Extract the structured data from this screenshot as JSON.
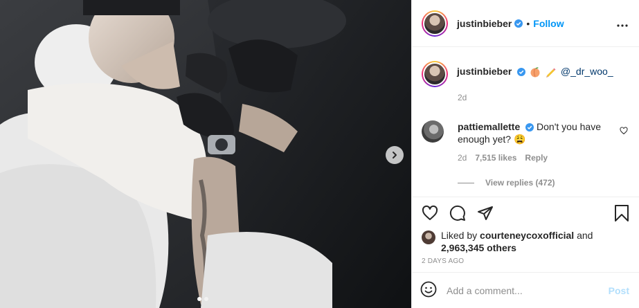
{
  "header": {
    "username": "justinbieber",
    "follow_label": "Follow",
    "separator": "•"
  },
  "caption": {
    "username": "justinbieber",
    "mention": "@_dr_woo_",
    "time": "2d"
  },
  "comment": {
    "username": "pattiemallette",
    "text": "Don't you have enough yet? 😩",
    "time": "2d",
    "likes": "7,515 likes",
    "reply_label": "Reply",
    "view_replies": "View replies (472)"
  },
  "likes": {
    "prefix": "Liked by ",
    "user": "courteneycoxofficial",
    "middle": " and",
    "others": "2,963,345 others"
  },
  "posted": "2 DAYS AGO",
  "add_comment": {
    "placeholder": "Add a comment...",
    "post_label": "Post"
  },
  "colors": {
    "accent": "#0095f6",
    "verified": "#3897f0",
    "muted": "#8e8e8e",
    "post_disabled": "#b2dffc"
  },
  "icons": [
    "more-options-icon",
    "verified-badge-icon",
    "peach-emoji-icon",
    "pencil-emoji-icon",
    "heart-icon",
    "comment-icon",
    "share-icon",
    "bookmark-icon",
    "emoji-icon",
    "chevron-right-icon"
  ]
}
